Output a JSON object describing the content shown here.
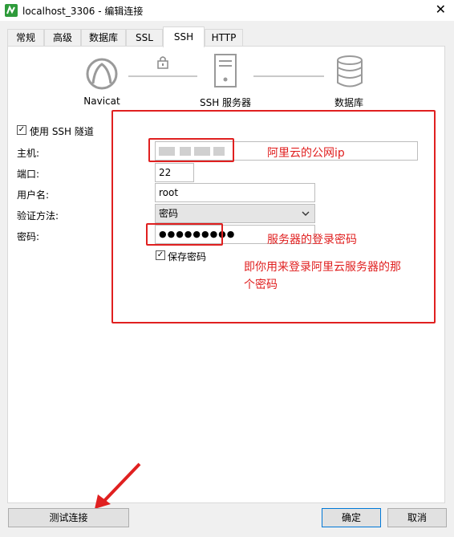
{
  "window": {
    "title": "localhost_3306 - 编辑连接",
    "close": "✕"
  },
  "tabs": [
    "常规",
    "高级",
    "数据库",
    "SSL",
    "SSH",
    "HTTP"
  ],
  "diagram": {
    "left": "Navicat",
    "middle": "SSH 服务器",
    "right": "数据库"
  },
  "form": {
    "use_ssh_label": "使用 SSH 隧道",
    "use_ssh_checked": true,
    "host_label": "主机:",
    "port_label": "端口:",
    "port_value": "22",
    "user_label": "用户名:",
    "user_value": "root",
    "auth_label": "验证方法:",
    "auth_value": "密码",
    "password_label": "密码:",
    "password_value": "●●●●●●●●●",
    "save_password_label": "保存密码",
    "save_password_checked": true
  },
  "annotations": {
    "host_note": "阿里云的公网ip",
    "password_note": "服务器的登录密码",
    "password_note2_line1": "即你用来登录阿里云服务器的那",
    "password_note2_line2": "个密码"
  },
  "buttons": {
    "test": "测试连接",
    "ok": "确定",
    "cancel": "取消"
  },
  "colors": {
    "annotation": "#e02020",
    "primary_border": "#0078d7"
  }
}
